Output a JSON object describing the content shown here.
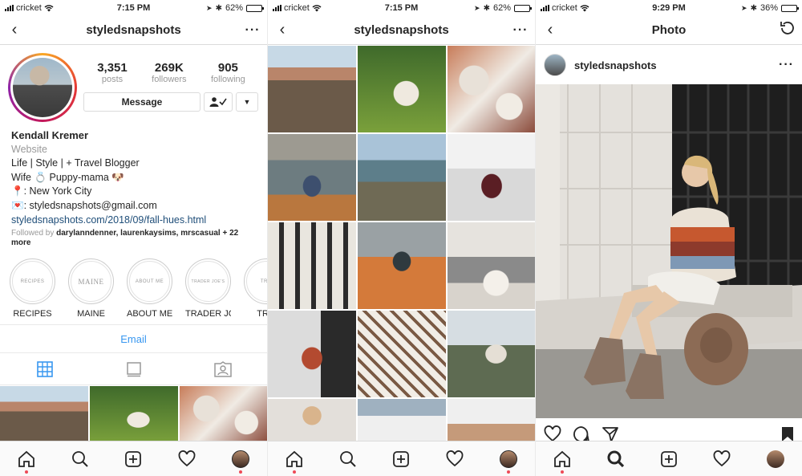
{
  "screens": [
    {
      "status": {
        "carrier": "cricket",
        "time": "7:15 PM",
        "battery": "62%",
        "battery_level": 0.62
      },
      "nav": {
        "title": "styledsnapshots"
      },
      "stats": [
        {
          "number": "3,351",
          "label": "posts"
        },
        {
          "number": "269K",
          "label": "followers"
        },
        {
          "number": "905",
          "label": "following"
        }
      ],
      "message_button": "Message",
      "bio": {
        "name": "Kendall Kremer",
        "category": "Website",
        "line1": "Life | Style | + Travel Blogger",
        "line2": "Wife 💍 Puppy-mama 🐶",
        "line3": "📍: New York City",
        "line4": "💌: styledsnapshots@gmail.com",
        "link": "styledsnapshots.com/2018/09/fall-hues.html",
        "followed_prefix": "Followed by",
        "followed_names": "darylanndenner, laurenkaysims, mrscasual",
        "followed_more": "+ 22 more"
      },
      "highlights": [
        {
          "cover": "RECIPES",
          "label": "RECIPES"
        },
        {
          "cover": "MAINE",
          "label": "MAINE"
        },
        {
          "cover": "ABOUT ME",
          "label": "ABOUT ME"
        },
        {
          "cover": "TRADER JOE'S",
          "label": "TRADER JO..."
        },
        {
          "cover": "TRY-",
          "label": "TRY-"
        }
      ],
      "email_button": "Email"
    },
    {
      "status": {
        "carrier": "cricket",
        "time": "7:15 PM",
        "battery": "62%",
        "battery_level": 0.62
      },
      "nav": {
        "title": "styledsnapshots"
      }
    },
    {
      "status": {
        "carrier": "cricket",
        "time": "9:29 PM",
        "battery": "36%",
        "battery_level": 0.36
      },
      "nav": {
        "title": "Photo"
      },
      "post": {
        "username": "styledsnapshots"
      }
    }
  ],
  "colors": {
    "accent_blue": "#3897f0",
    "link": "#1f4e79",
    "notification": "#ed4956"
  },
  "icons": [
    "back-icon",
    "more-icon",
    "grid-icon",
    "feed-icon",
    "tagged-icon",
    "home-icon",
    "search-icon",
    "add-icon",
    "heart-icon",
    "profile-icon",
    "refresh-icon",
    "comment-icon",
    "share-icon",
    "bookmark-icon",
    "follow-check-icon",
    "dropdown-icon"
  ]
}
